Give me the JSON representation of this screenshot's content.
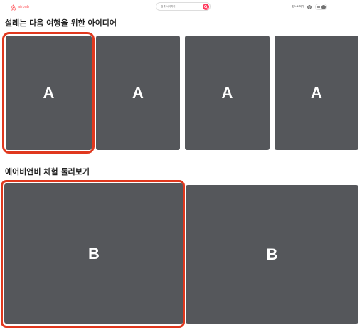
{
  "header": {
    "logo_text": "airbnb",
    "search_placeholder": "검색 시작하기",
    "host_label": "호스트 되기",
    "brand_color": "#ff5a5f",
    "search_button_color": "#ff385c"
  },
  "sections": [
    {
      "title": "설레는 다음 여행을 위한 아이디어",
      "cards": [
        {
          "label": "A"
        },
        {
          "label": "A"
        },
        {
          "label": "A"
        },
        {
          "label": "A"
        }
      ]
    },
    {
      "title": "에어비앤비 체험 둘러보기",
      "cards": [
        {
          "label": "B"
        },
        {
          "label": "B"
        }
      ]
    }
  ],
  "colors": {
    "card_background": "#55575b",
    "highlight_outline": "#e0381e"
  },
  "icons": [
    "airbnb-logo-icon",
    "search-icon",
    "globe-icon",
    "menu-icon",
    "avatar-icon"
  ]
}
